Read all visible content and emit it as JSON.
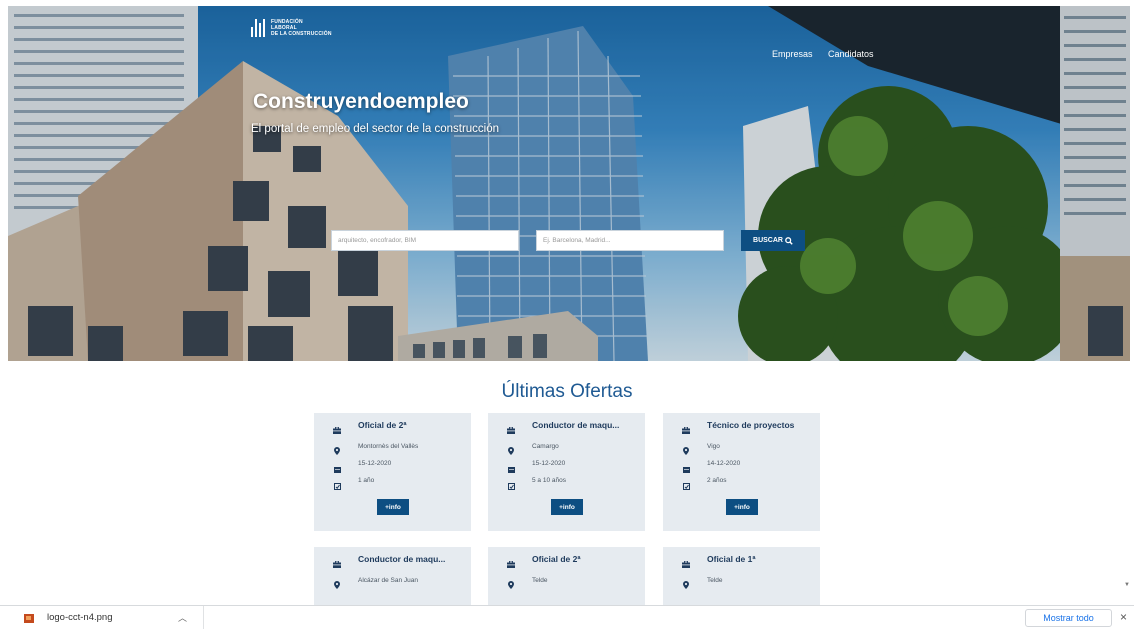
{
  "brand": {
    "logo_lines": [
      "FUNDACIÓN",
      "LABORAL",
      "DE LA CONSTRUCCIÓN"
    ]
  },
  "nav": {
    "items": [
      {
        "label": "Empresas"
      },
      {
        "label": "Candidatos"
      }
    ]
  },
  "hero": {
    "title": "Construyendoempleo",
    "subtitle": "El portal de empleo del sector de la construcción",
    "search_job_placeholder": "arquitecto, encofrador, BIM",
    "search_location_placeholder": "Ej. Barcelona, Madrid...",
    "search_button_label": "BUSCAR"
  },
  "offers": {
    "title": "Últimas Ofertas",
    "info_label": "+info",
    "cards": [
      {
        "title": "Oficial de 2ª",
        "location": "Montornès del Vallès",
        "date": "15-12-2020",
        "experience": "1 año"
      },
      {
        "title": "Conductor de maqu...",
        "location": "Camargo",
        "date": "15-12-2020",
        "experience": "5 a 10 años"
      },
      {
        "title": "Técnico de proyectos",
        "location": "Vigo",
        "date": "14-12-2020",
        "experience": "2 años"
      },
      {
        "title": "Conductor de maqu...",
        "location": "Alcázar de San Juan"
      },
      {
        "title": "Oficial de 2ª",
        "location": "Telde"
      },
      {
        "title": "Oficial de 1ª",
        "location": "Telde"
      }
    ]
  },
  "download_bar": {
    "filename": "logo-cct-n4.png",
    "show_all_label": "Mostrar todo",
    "close_label": "×"
  },
  "colors": {
    "primary": "#0d4e82",
    "heading": "#1f5a93",
    "card_bg": "#e6ebf0"
  }
}
